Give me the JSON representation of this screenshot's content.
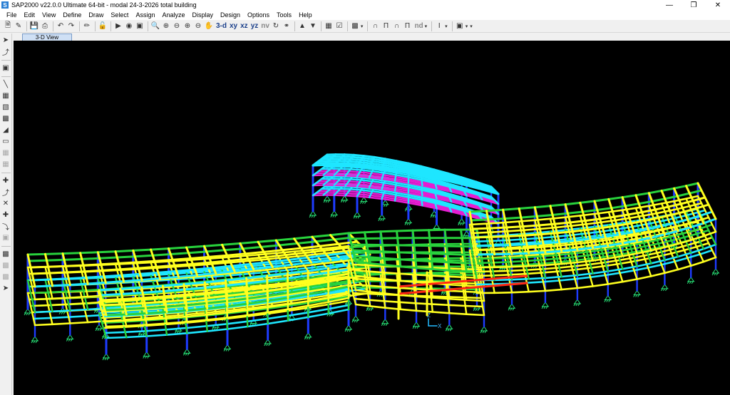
{
  "window": {
    "app_icon": "S",
    "title": "SAP2000 v22.0.0 Ultimate 64-bit - modal 24-3-2026 total building",
    "controls": [
      "minimize-icon",
      "restore-icon",
      "close-icon"
    ]
  },
  "menu": [
    "File",
    "Edit",
    "View",
    "Define",
    "Draw",
    "Select",
    "Assign",
    "Analyze",
    "Display",
    "Design",
    "Options",
    "Tools",
    "Help"
  ],
  "toolbar": {
    "view_3d": "3-d",
    "view_xy": "xy",
    "view_xz": "xz",
    "view_yz": "yz",
    "view_nv": "nv",
    "nd_label": "nd"
  },
  "tab": {
    "label": "3-D View"
  },
  "viewport": {
    "background": "#000000",
    "axis_labels": {
      "x": "X",
      "z": "Z"
    }
  },
  "colors": {
    "column": "#1e3cff",
    "beam_green": "#28d23c",
    "beam_yellow": "#ffff1e",
    "beam_cyan": "#1ee6ff",
    "beam_magenta": "#e61ed2",
    "beam_red": "#ff2814",
    "support": "#28e678"
  }
}
